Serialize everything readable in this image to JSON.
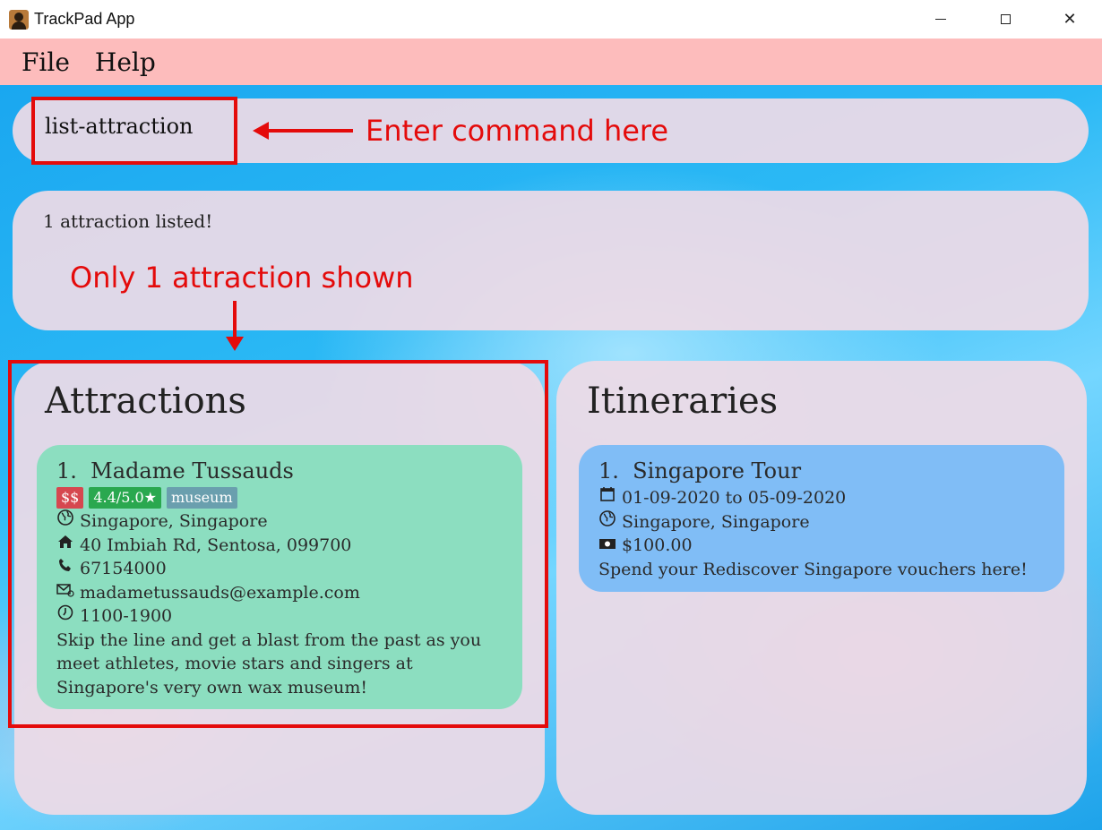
{
  "window": {
    "title": "TrackPad App",
    "icon": "person-icon",
    "controls": {
      "minimize": "minimize-icon",
      "maximize": "maximize-icon",
      "close": "✕"
    }
  },
  "menu": {
    "items": [
      "File",
      "Help"
    ]
  },
  "command": {
    "value": "list-attraction"
  },
  "result": {
    "message": "1 attraction listed!"
  },
  "annotations": {
    "command_hint": "Enter command here",
    "list_hint": "Only 1 attraction shown",
    "color": "#e40b0b"
  },
  "attractions": {
    "title": "Attractions",
    "items": [
      {
        "index": "1.",
        "name": "Madame Tussauds",
        "price": "$$",
        "rating": "4.4/5.0★",
        "tag": "museum",
        "location": "Singapore, Singapore",
        "address": "40 Imbiah Rd, Sentosa, 099700",
        "phone": "67154000",
        "email": "madametussauds@example.com",
        "hours": "1100-1900",
        "description": "Skip the line and get a blast from the past as you meet athletes, movie stars and singers at Singapore's very own wax museum!"
      }
    ]
  },
  "itineraries": {
    "title": "Itineraries",
    "items": [
      {
        "index": "1.",
        "name": "Singapore Tour",
        "dates": "01-09-2020 to 05-09-2020",
        "location": "Singapore, Singapore",
        "budget": "$100.00",
        "description": "Spend your Rediscover Singapore vouchers here!"
      }
    ]
  },
  "colors": {
    "menubar": "#fdbcbc",
    "attraction_card": "#8cdec0",
    "itinerary_card": "#80bdf6",
    "price_badge": "#d6474f",
    "rating_badge": "#2aa84f",
    "tag_badge": "#6a9fae"
  }
}
